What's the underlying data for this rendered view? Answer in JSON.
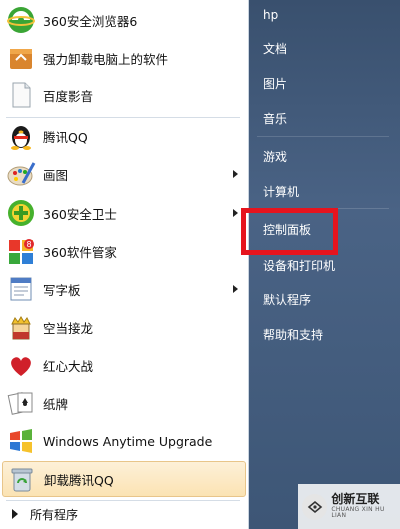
{
  "programs": [
    {
      "label": "360安全浏览器6",
      "icon": "browser-360-icon",
      "has_submenu": false
    },
    {
      "label": "强力卸载电脑上的软件",
      "icon": "uninstall-box-icon",
      "has_submenu": false
    },
    {
      "label": "百度影音",
      "icon": "document-icon",
      "has_submenu": false
    },
    {
      "label": "腾讯QQ",
      "icon": "qq-penguin-icon",
      "has_submenu": false
    },
    {
      "label": "画图",
      "icon": "paint-palette-icon",
      "has_submenu": true
    },
    {
      "label": "360安全卫士",
      "icon": "security-360-icon",
      "has_submenu": true
    },
    {
      "label": "360软件管家",
      "icon": "software-manager-icon",
      "has_submenu": false
    },
    {
      "label": "写字板",
      "icon": "wordpad-icon",
      "has_submenu": true
    },
    {
      "label": "空当接龙",
      "icon": "freecell-king-icon",
      "has_submenu": false
    },
    {
      "label": "红心大战",
      "icon": "hearts-icon",
      "has_submenu": false
    },
    {
      "label": "纸牌",
      "icon": "solitaire-cards-icon",
      "has_submenu": false
    },
    {
      "label": "Windows Anytime Upgrade",
      "icon": "windows-flag-icon",
      "has_submenu": false
    },
    {
      "label": "卸载腾讯QQ",
      "icon": "recycle-bin-icon",
      "has_submenu": false,
      "highlighted": true
    }
  ],
  "all_programs": "所有程序",
  "right_items": [
    {
      "label": "hp"
    },
    {
      "label": "文档"
    },
    {
      "label": "图片"
    },
    {
      "label": "音乐"
    },
    {
      "label": "游戏"
    },
    {
      "label": "计算机"
    },
    {
      "label": "控制面板",
      "annotated": true
    },
    {
      "label": "设备和打印机"
    },
    {
      "label": "默认程序"
    },
    {
      "label": "帮助和支持"
    }
  ],
  "watermark": {
    "name": "创新互联",
    "sub": "CHUANG XIN HU LIAN"
  },
  "colors": {
    "annotation_red": "#e6141e",
    "highlight": "#fbe3b3",
    "right_pane": "#4a6385"
  }
}
